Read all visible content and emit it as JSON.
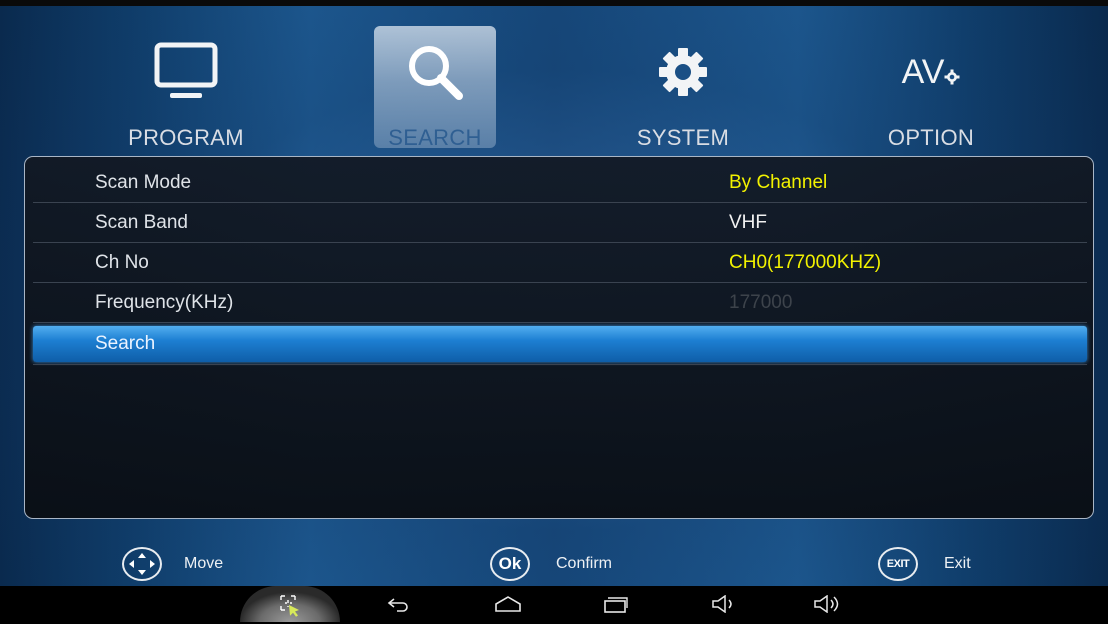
{
  "tabs": [
    {
      "label": "PROGRAM",
      "icon": "tv-icon",
      "active": false
    },
    {
      "label": "SEARCH",
      "icon": "search-icon",
      "active": true
    },
    {
      "label": "SYSTEM",
      "icon": "gear-icon",
      "active": false
    },
    {
      "label": "OPTION",
      "icon": "av-settings-icon",
      "active": false
    },
    {
      "av_text": "AV"
    }
  ],
  "rows": [
    {
      "label": "Scan Mode",
      "value": "By Channel"
    },
    {
      "label": "Scan Band",
      "value": "VHF"
    },
    {
      "label": "Ch No",
      "value": "CH0(177000KHZ)"
    },
    {
      "label": "Frequency(KHz)",
      "value": "177000"
    },
    {
      "label": "Search",
      "value": ""
    }
  ],
  "hints": [
    {
      "icon": "dpad-icon",
      "label": "Move"
    },
    {
      "icon": "ok-icon",
      "badge": "Ok",
      "label": "Confirm"
    },
    {
      "icon": "exit-icon",
      "badge": "EXIT",
      "label": "Exit"
    }
  ],
  "navbar": [
    "cursor-icon",
    "back-icon",
    "home-icon",
    "recent-apps-icon",
    "volume-down-icon",
    "volume-up-icon"
  ],
  "colors": {
    "highlight_value": "#f2f200",
    "selection": "#1d7fd2",
    "disabled_value": "#3d434b"
  }
}
